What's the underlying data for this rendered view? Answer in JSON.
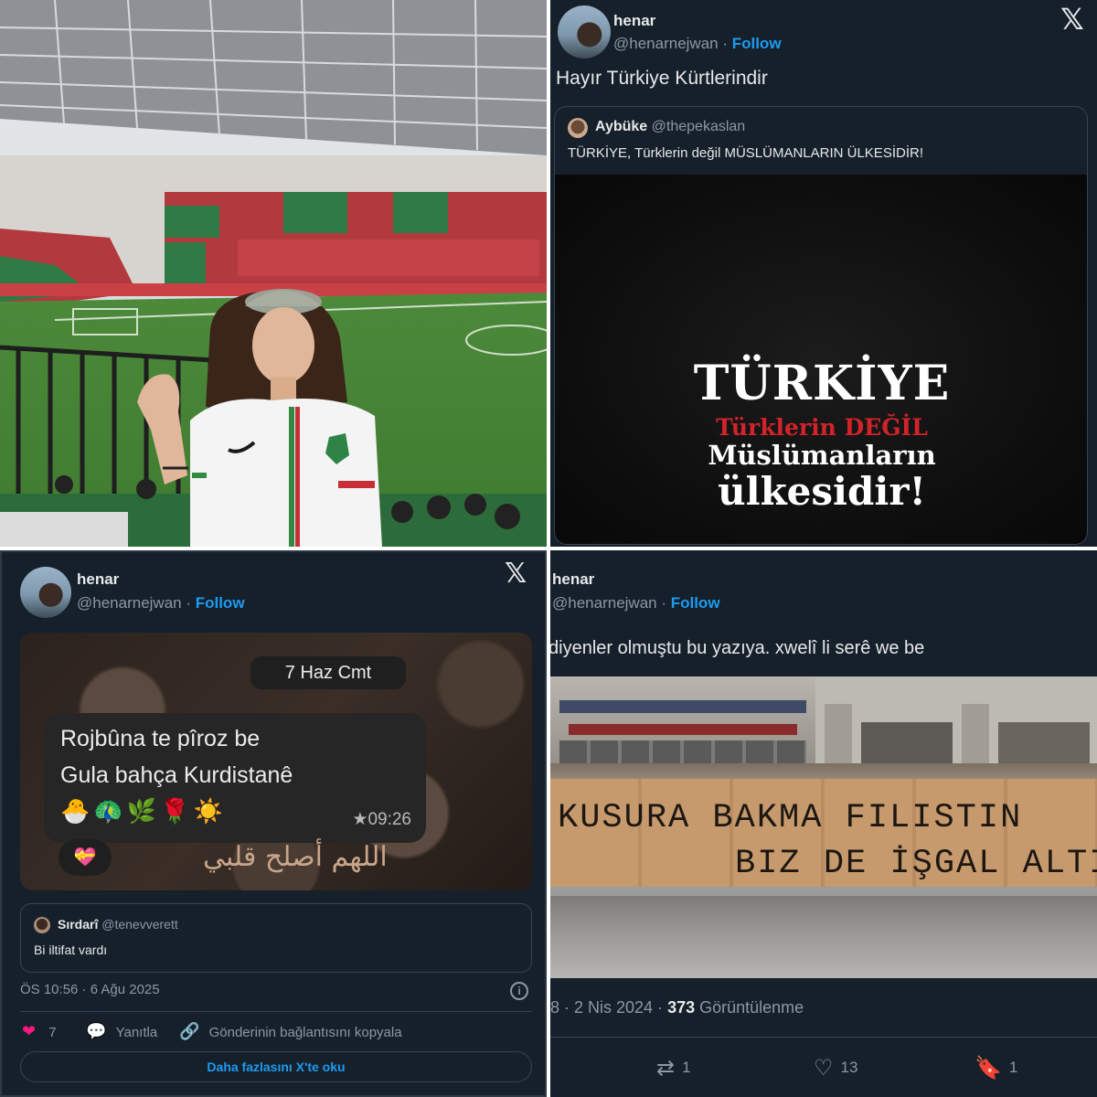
{
  "panel_tr": {
    "user_name": "henar",
    "handle": "@henarnejwan",
    "follow": "Follow",
    "tweet_text": "Hayır Türkiye Kürtlerindir",
    "quote": {
      "user_name": "Aybüke",
      "handle": "@thepekaslan",
      "text": "TÜRKİYE, Türklerin değil MÜSLÜMANLARIN ÜLKESİDİR!",
      "poster": {
        "line1": "TÜRKİYE",
        "line2": "Türklerin DEĞİL",
        "line3": "Müslümanların",
        "line4": "ülkesidir!"
      }
    }
  },
  "panel_bl": {
    "user_name": "henar",
    "handle": "@henarnejwan",
    "follow": "Follow",
    "chat": {
      "date": "7 Haz Cmt",
      "line1": "Rojbûna te pîroz be",
      "line2": "Gula bahça Kurdistanê",
      "emojis": "🐣🦚🌿🌹☀️",
      "time": "★09:26",
      "reaction": "💝",
      "arabic": "اللهم أصلح قلبي"
    },
    "quote": {
      "user_name": "Sırdarî",
      "handle": "@tenevverett",
      "text": "Bi iltifat vardı"
    },
    "timestamp": "ÖS 10:56 · 6 Ağu 2025",
    "likes": "7",
    "reply": "Yanıtla",
    "copy_link": "Gönderinin bağlantısını kopyala",
    "read_more": "Daha fazlasını X'te oku"
  },
  "panel_br": {
    "user_name": "henar",
    "handle": "@henarnejwan",
    "follow": "Follow",
    "tweet_text": "diyenler olmuştu bu yazıya. xwelî li serê we be",
    "graffiti_line1": "KUSURA BAKMA FILISTIN",
    "graffiti_line2": "BIZ DE İŞGAL ALTINDA",
    "meta_date": "8 · 2 Nis 2024 · ",
    "views_count": "373",
    "views_label": " Görüntülenme",
    "retweets": "1",
    "likes": "13",
    "bookmarks": "1"
  },
  "colors": {
    "background": "#15202b",
    "text": "#e7e9ea",
    "muted": "#8b98a5",
    "link": "#1d9bf0",
    "poster_red": "#d2232a",
    "like_pink": "#f91880"
  },
  "icons": [
    "x-logo-icon",
    "info-icon",
    "heart-icon",
    "reply-bubble-icon",
    "link-icon",
    "retweet-icon",
    "bookmark-icon"
  ]
}
